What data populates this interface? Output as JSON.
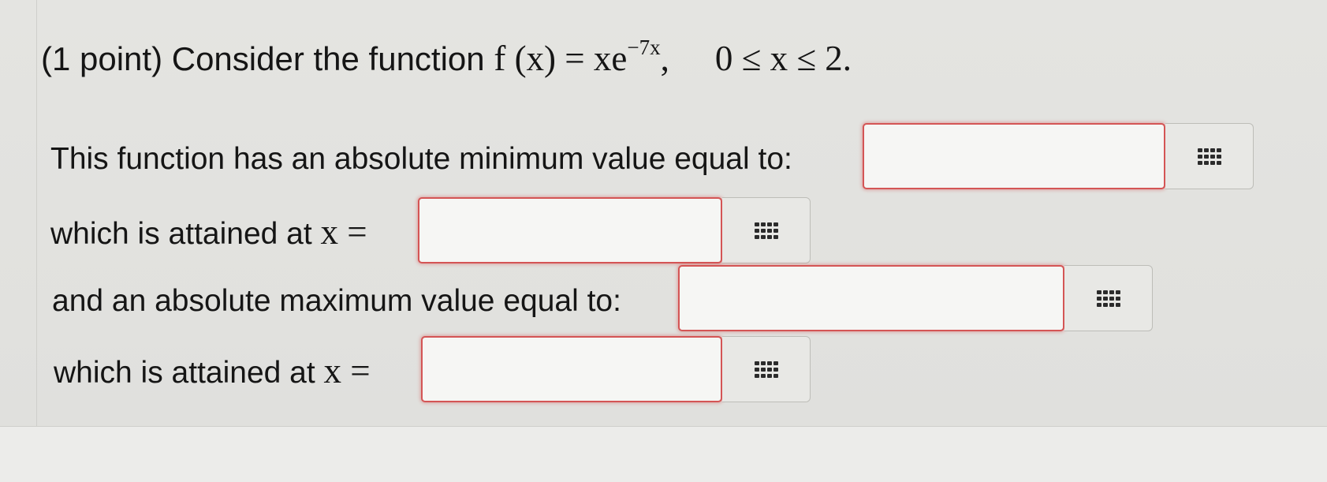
{
  "problem": {
    "prefix": "(1 point) Consider the function",
    "function_lhs": "f (x) = xe",
    "exponent": "−7x",
    "comma": ",",
    "domain": "0 ≤ x ≤ 2."
  },
  "questions": [
    {
      "label": "This function has an absolute minimum value equal to:",
      "value": "",
      "icon": "grid-keypad-icon"
    },
    {
      "label": "which is attained at",
      "math": "x =",
      "value": "",
      "icon": "grid-keypad-icon"
    },
    {
      "label": "and an absolute maximum value equal to:",
      "value": "",
      "icon": "grid-keypad-icon"
    },
    {
      "label": "which is attained at",
      "math": "x =",
      "value": "",
      "icon": "grid-keypad-icon"
    }
  ],
  "colors": {
    "input_border": "#d45555",
    "background": "#e2e2df"
  }
}
